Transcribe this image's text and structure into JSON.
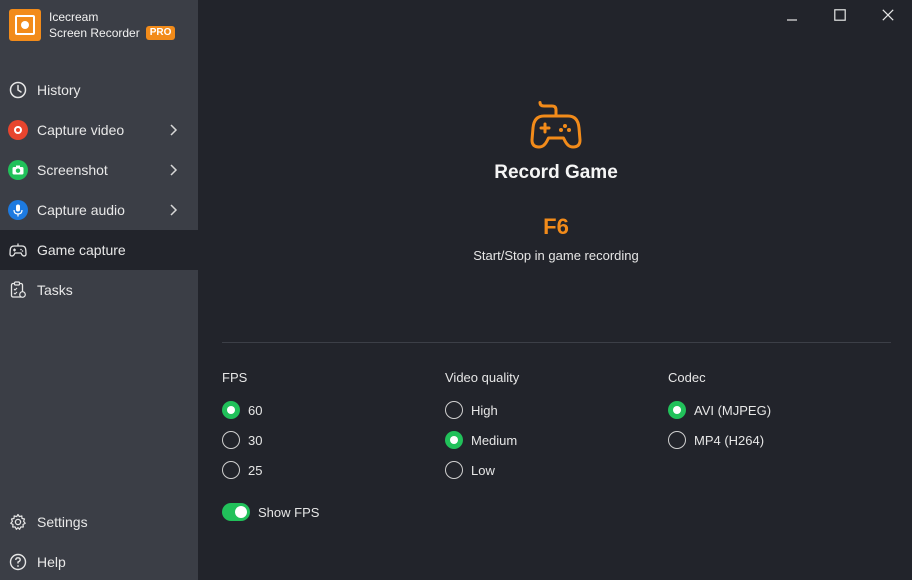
{
  "app": {
    "name_line1": "Icecream",
    "name_line2": "Screen Recorder",
    "badge": "PRO",
    "accent": "#f28b1a",
    "green": "#21c15a"
  },
  "sidebar": {
    "items": [
      {
        "label": "History",
        "icon": "clock-icon",
        "has_submenu": false
      },
      {
        "label": "Capture video",
        "icon": "record-icon",
        "has_submenu": true
      },
      {
        "label": "Screenshot",
        "icon": "camera-icon",
        "has_submenu": true
      },
      {
        "label": "Capture audio",
        "icon": "microphone-icon",
        "has_submenu": true
      },
      {
        "label": "Game capture",
        "icon": "gamepad-icon",
        "has_submenu": false,
        "active": true
      },
      {
        "label": "Tasks",
        "icon": "tasks-icon",
        "has_submenu": false
      }
    ],
    "bottom": [
      {
        "label": "Settings",
        "icon": "gear-icon"
      },
      {
        "label": "Help",
        "icon": "help-icon"
      }
    ]
  },
  "main": {
    "title": "Record Game",
    "hotkey": "F6",
    "hotkey_desc": "Start/Stop in game recording",
    "fps": {
      "title": "FPS",
      "options": [
        "60",
        "30",
        "25"
      ],
      "selected": "60"
    },
    "quality": {
      "title": "Video quality",
      "options": [
        "High",
        "Medium",
        "Low"
      ],
      "selected": "Medium"
    },
    "codec": {
      "title": "Codec",
      "options": [
        "AVI (MJPEG)",
        "MP4 (H264)"
      ],
      "selected": "AVI (MJPEG)"
    },
    "show_fps": {
      "label": "Show FPS",
      "on": true
    }
  }
}
